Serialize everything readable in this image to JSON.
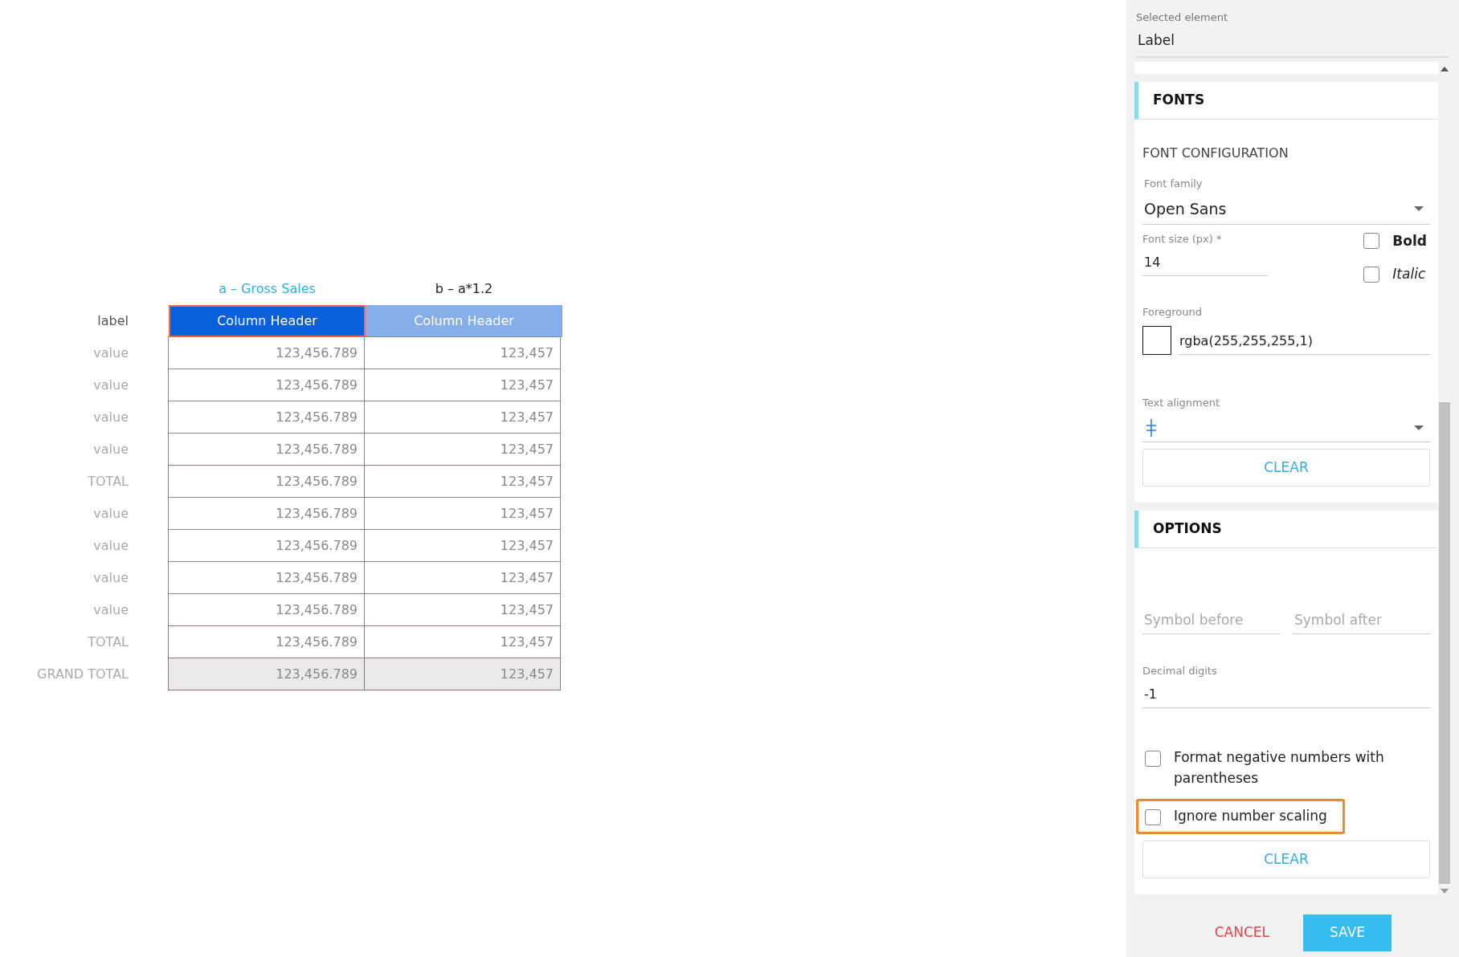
{
  "table": {
    "column_titles": [
      {
        "text": "a – Gross Sales",
        "selected": true
      },
      {
        "text": "b – a*1.2",
        "selected": false
      }
    ],
    "header_label": "label",
    "column_headers": [
      {
        "text": "Column Header",
        "selected": true
      },
      {
        "text": "Column Header",
        "selected": false
      }
    ],
    "rows": [
      {
        "label": "value",
        "kind": "value",
        "cells": [
          "123,456.789",
          "123,457"
        ]
      },
      {
        "label": "value",
        "kind": "value",
        "cells": [
          "123,456.789",
          "123,457"
        ]
      },
      {
        "label": "value",
        "kind": "value",
        "cells": [
          "123,456.789",
          "123,457"
        ]
      },
      {
        "label": "value",
        "kind": "value",
        "cells": [
          "123,456.789",
          "123,457"
        ]
      },
      {
        "label": "TOTAL",
        "kind": "total",
        "cells": [
          "123,456.789",
          "123,457"
        ]
      },
      {
        "label": "value",
        "kind": "value",
        "cells": [
          "123,456.789",
          "123,457"
        ]
      },
      {
        "label": "value",
        "kind": "value",
        "cells": [
          "123,456.789",
          "123,457"
        ]
      },
      {
        "label": "value",
        "kind": "value",
        "cells": [
          "123,456.789",
          "123,457"
        ]
      },
      {
        "label": "value",
        "kind": "value",
        "cells": [
          "123,456.789",
          "123,457"
        ]
      },
      {
        "label": "TOTAL",
        "kind": "total",
        "cells": [
          "123,456.789",
          "123,457"
        ]
      },
      {
        "label": "GRAND TOTAL",
        "kind": "grand_total",
        "cells": [
          "123,456.789",
          "123,457"
        ]
      }
    ]
  },
  "panel": {
    "selected_element": {
      "label": "Selected element",
      "value": "Label"
    },
    "fonts": {
      "title": "FONTS",
      "subtitle": "FONT CONFIGURATION",
      "font_family": {
        "label": "Font family",
        "value": "Open Sans"
      },
      "font_size": {
        "label": "Font size (px) *",
        "value": "14"
      },
      "styles": [
        {
          "label": "Bold",
          "kind": "bold",
          "checked": false
        },
        {
          "label": "Italic",
          "kind": "italic",
          "checked": false
        }
      ],
      "foreground": {
        "label": "Foreground",
        "value": "rgba(255,255,255,1)",
        "color": "#ffffff"
      },
      "text_alignment": {
        "label": "Text alignment"
      },
      "clear": "CLEAR"
    },
    "options": {
      "title": "OPTIONS",
      "symbol_before": {
        "placeholder": "Symbol before"
      },
      "symbol_after": {
        "placeholder": "Symbol after"
      },
      "decimal_digits": {
        "label": "Decimal digits",
        "value": "-1"
      },
      "checks": [
        {
          "label": "Format negative numbers with parentheses",
          "checked": false,
          "highlighted": false
        },
        {
          "label": "Ignore number scaling",
          "checked": false,
          "highlighted": true
        }
      ],
      "clear": "CLEAR"
    },
    "cancel": "CANCEL",
    "save": "SAVE"
  }
}
